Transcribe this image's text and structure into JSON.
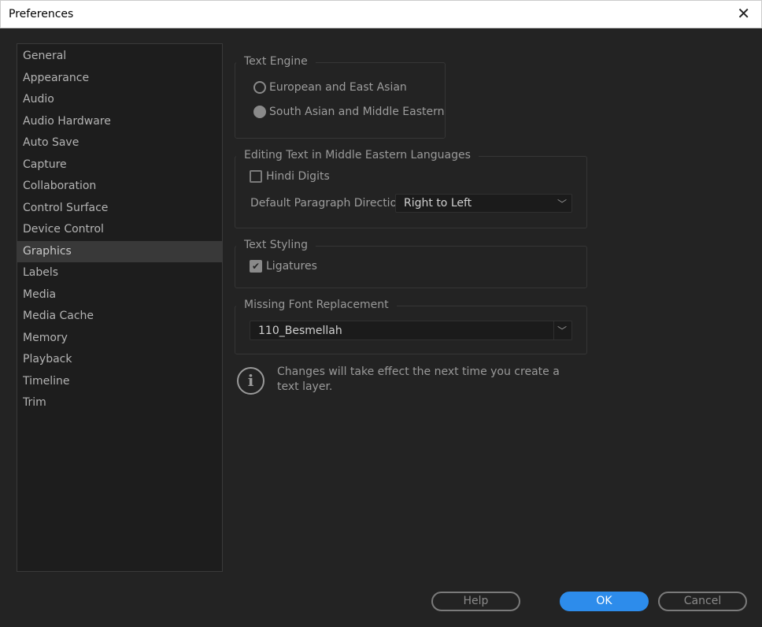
{
  "window": {
    "title": "Preferences",
    "close_icon": "close-icon"
  },
  "sidebar": {
    "items": [
      {
        "label": "General"
      },
      {
        "label": "Appearance"
      },
      {
        "label": "Audio"
      },
      {
        "label": "Audio Hardware"
      },
      {
        "label": "Auto Save"
      },
      {
        "label": "Capture"
      },
      {
        "label": "Collaboration"
      },
      {
        "label": "Control Surface"
      },
      {
        "label": "Device Control"
      },
      {
        "label": "Graphics",
        "selected": true
      },
      {
        "label": "Labels"
      },
      {
        "label": "Media"
      },
      {
        "label": "Media Cache"
      },
      {
        "label": "Memory"
      },
      {
        "label": "Playback"
      },
      {
        "label": "Timeline"
      },
      {
        "label": "Trim"
      }
    ]
  },
  "text_engine": {
    "legend": "Text Engine",
    "options": [
      {
        "label": "European and East Asian",
        "selected": false
      },
      {
        "label": "South Asian and Middle Eastern",
        "selected": true
      }
    ]
  },
  "middle_eastern": {
    "legend": "Editing Text in Middle Eastern Languages",
    "hindi_digits": {
      "label": "Hindi Digits",
      "checked": false
    },
    "direction_label": "Default Paragraph Direction:",
    "direction_value": "Right to Left"
  },
  "text_styling": {
    "legend": "Text Styling",
    "ligatures": {
      "label": "Ligatures",
      "checked": true
    }
  },
  "missing_font": {
    "legend": "Missing Font Replacement",
    "value": "110_Besmellah"
  },
  "info": {
    "icon": "info-icon",
    "text": "Changes will take effect the next time you create a text layer."
  },
  "buttons": {
    "help": "Help",
    "ok": "OK",
    "cancel": "Cancel"
  },
  "colors": {
    "accent": "#2d8ceb",
    "background": "#232323"
  }
}
